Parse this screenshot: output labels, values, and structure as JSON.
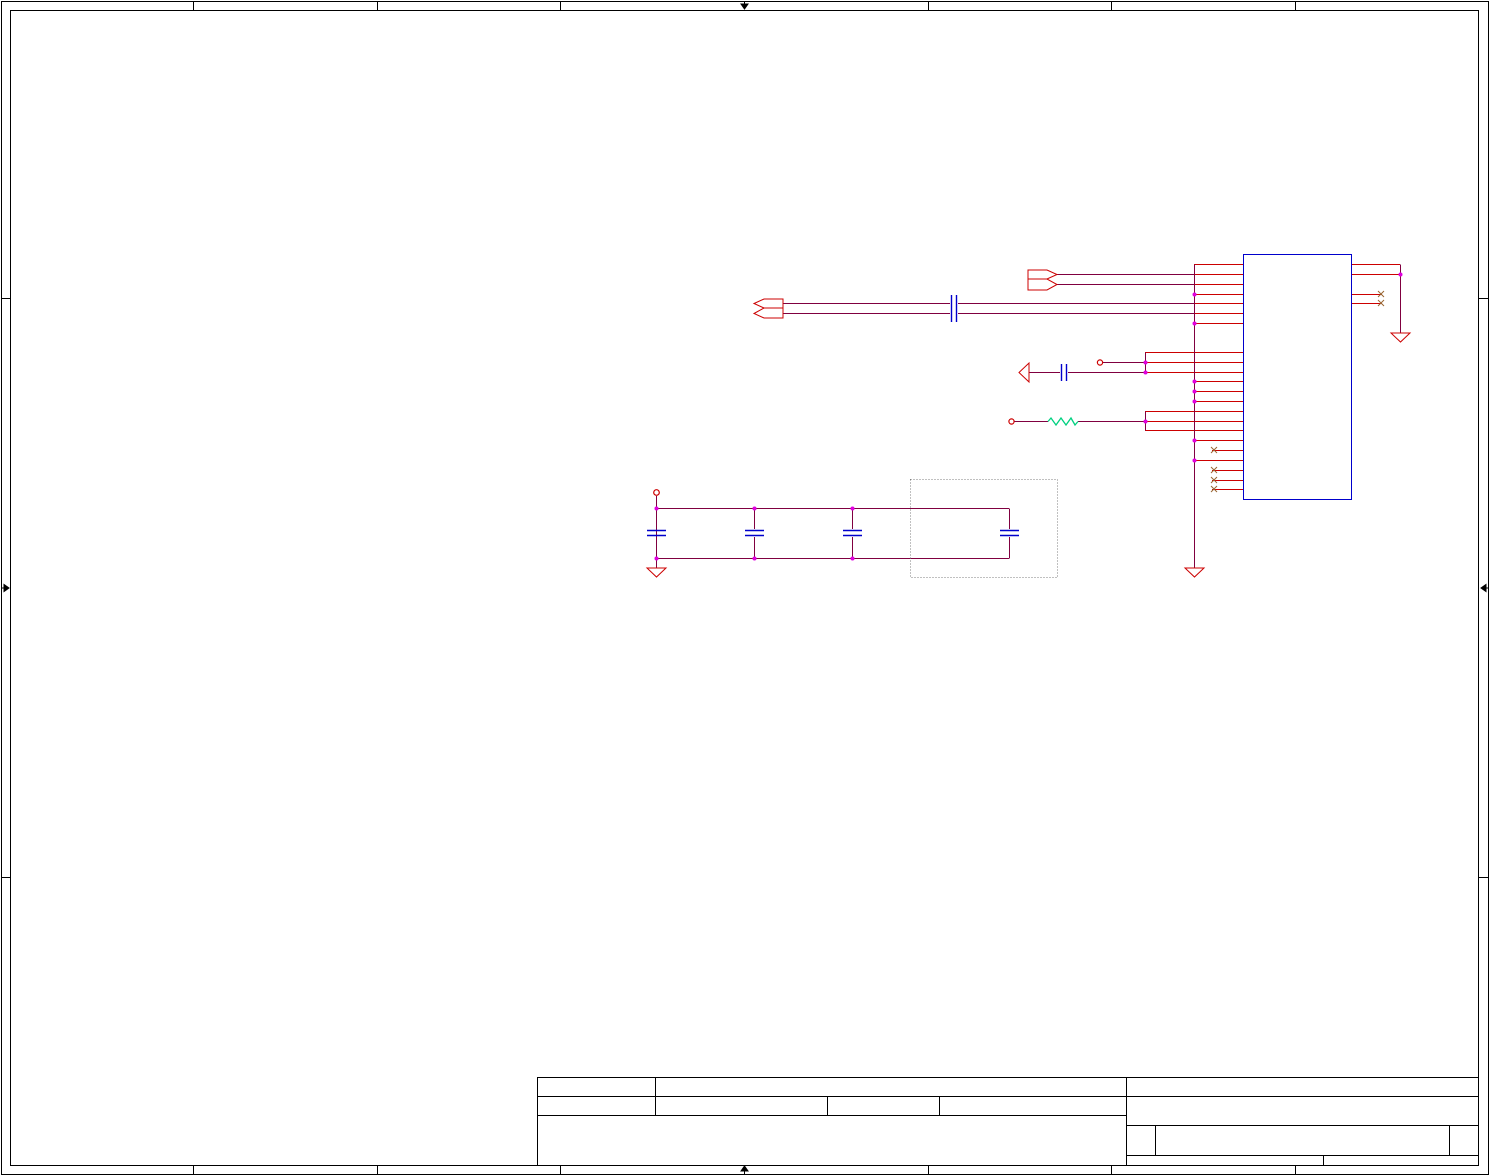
{
  "document": {
    "kind": "electronic schematic sheet",
    "colors": {
      "border": "#000000",
      "wire": "#800040",
      "pin": "#cc0000",
      "part": "#0000cc",
      "junction": "#e000e0",
      "power": "#cc0000",
      "resistor": "#00d080",
      "no_connect": "#996633",
      "group_box": "#808080"
    }
  },
  "title_block": {
    "visible_text": ""
  },
  "components": [
    {
      "name": "connector-ic",
      "type": "multi-pin header / IC body",
      "left_pins": 24,
      "right_pins": 4
    },
    {
      "name": "ac-coupling-capacitor",
      "type": "capacitor"
    },
    {
      "name": "decoupling-capacitor",
      "type": "capacitor"
    },
    {
      "name": "series-resistor",
      "type": "resistor"
    },
    {
      "name": "bulk-capacitor-1",
      "type": "capacitor"
    },
    {
      "name": "bulk-capacitor-2",
      "type": "capacitor"
    },
    {
      "name": "bulk-capacitor-3",
      "type": "capacitor"
    },
    {
      "name": "optional-capacitor",
      "type": "capacitor (in dotted group)"
    },
    {
      "name": "ground-symbol-right",
      "type": "ground"
    },
    {
      "name": "ground-symbol-main",
      "type": "ground"
    },
    {
      "name": "ground-symbol-decoupling",
      "type": "ground"
    },
    {
      "name": "ground-symbol-bulk",
      "type": "ground"
    }
  ]
}
